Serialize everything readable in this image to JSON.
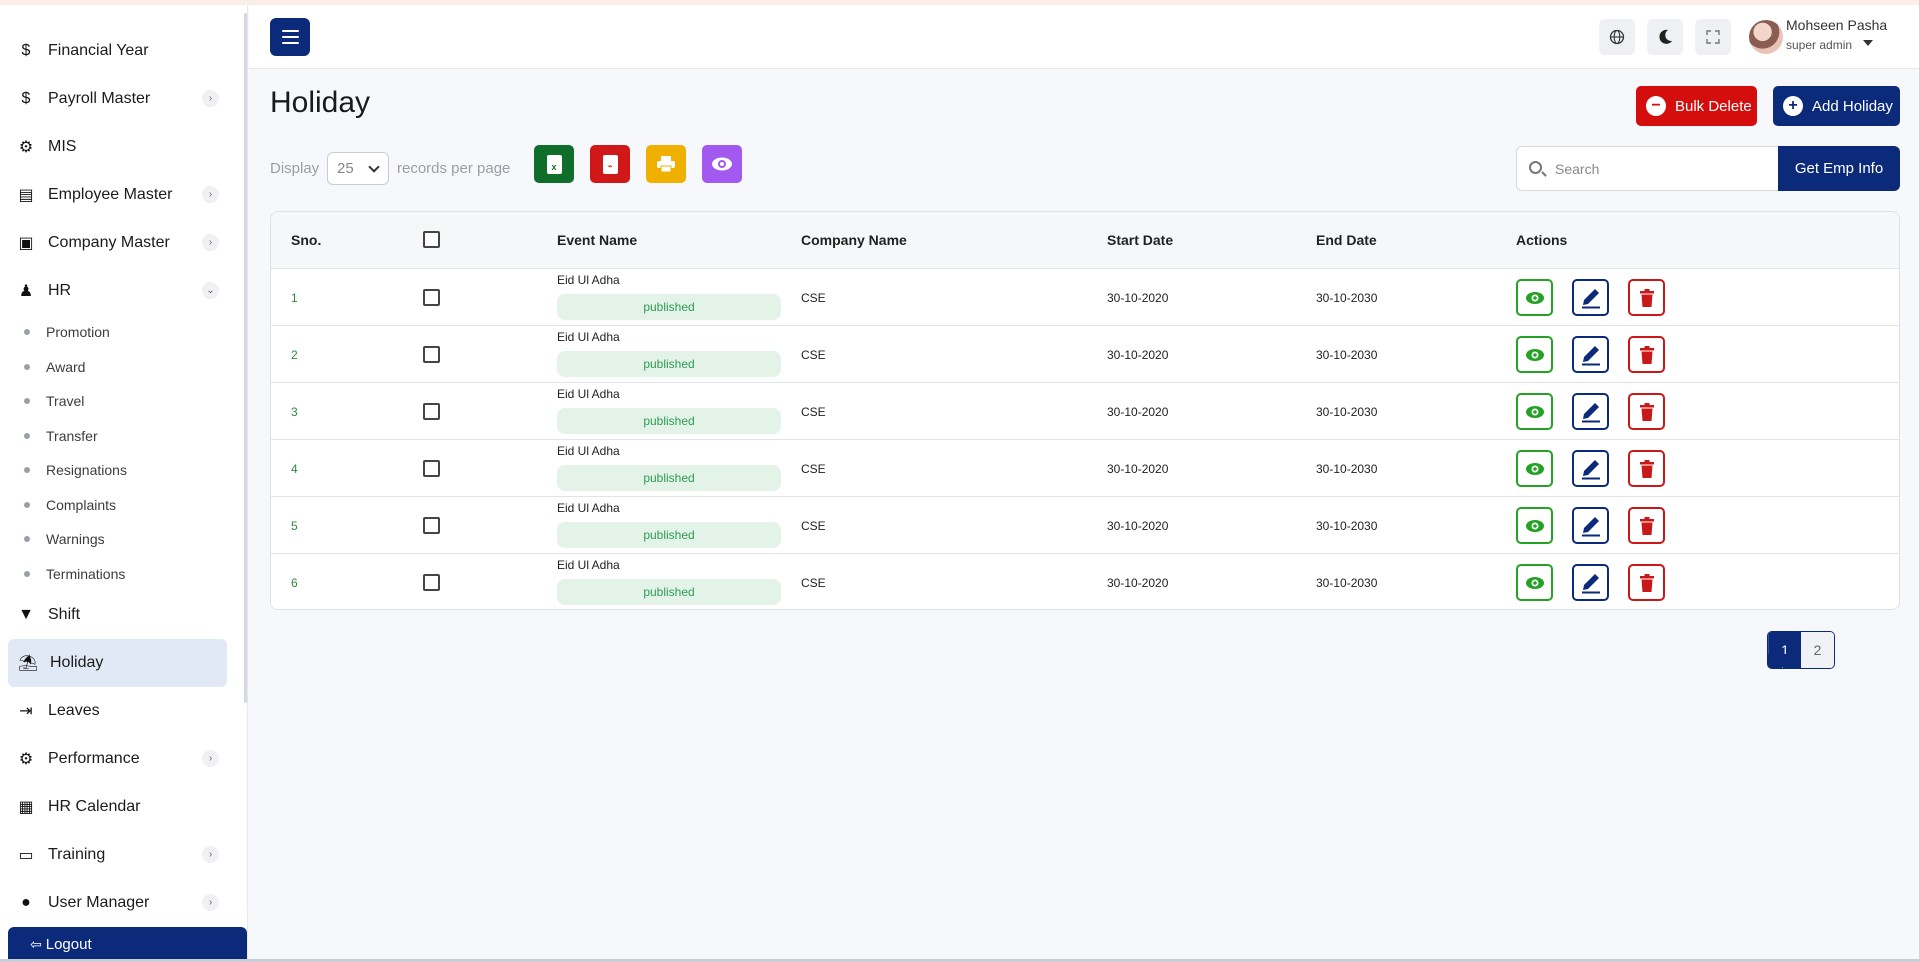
{
  "sidebar": {
    "items": [
      {
        "label": "Financial Year",
        "icon": "dollar-icon",
        "glyph": "$",
        "chevron": false
      },
      {
        "label": "Payroll Master",
        "icon": "dollar-icon",
        "glyph": "$",
        "chevron": true
      },
      {
        "label": "MIS",
        "icon": "user-gear-icon",
        "glyph": "⚙",
        "chevron": false
      },
      {
        "label": "Employee Master",
        "icon": "building-icon",
        "glyph": "▤",
        "chevron": true
      },
      {
        "label": "Company Master",
        "icon": "briefcase-icon",
        "glyph": "▣",
        "chevron": true
      },
      {
        "label": "HR",
        "icon": "users-icon",
        "glyph": "♟",
        "chevron": true,
        "expanded": true
      }
    ],
    "hr_sub_items": [
      "Promotion",
      "Award",
      "Travel",
      "Transfer",
      "Resignations",
      "Complaints",
      "Warnings",
      "Terminations"
    ],
    "items_after": [
      {
        "label": "Shift",
        "icon": "filter-icon",
        "glyph": "▼",
        "chevron": false
      },
      {
        "label": "Holiday",
        "icon": "umbrella-beach-icon",
        "glyph": "⛱",
        "chevron": false,
        "active": true
      },
      {
        "label": "Leaves",
        "icon": "sign-out-icon",
        "glyph": "⇥",
        "chevron": false
      },
      {
        "label": "Performance",
        "icon": "gears-icon",
        "glyph": "⚙",
        "chevron": true
      },
      {
        "label": "HR Calendar",
        "icon": "calendar-icon",
        "glyph": "▦",
        "chevron": false
      },
      {
        "label": "Training",
        "icon": "chalkboard-icon",
        "glyph": "▭",
        "chevron": true
      },
      {
        "label": "User Manager",
        "icon": "user-icon",
        "glyph": "●",
        "chevron": true
      }
    ],
    "logout_label": "Logout"
  },
  "topbar": {
    "user_name": "Mohseen Pasha",
    "user_role": "super admin"
  },
  "page": {
    "title": "Holiday",
    "bulk_delete_label": "Bulk Delete",
    "add_label": "Add Holiday",
    "display_label": "Display",
    "page_size": "25",
    "records_label": "records per page",
    "search_placeholder": "Search",
    "get_emp_label": "Get Emp Info"
  },
  "colors": {
    "primary": "#0b2a7a",
    "danger": "#d40d0d",
    "excel": "#0e6e2a",
    "pdf": "#d01818",
    "print": "#f0b000",
    "view": "#a259f0",
    "published_bg": "#e4f3e8",
    "published_text": "#2d9b52"
  },
  "table": {
    "columns": [
      "Sno.",
      "",
      "Event Name",
      "Company Name",
      "Start Date",
      "End Date",
      "Actions"
    ],
    "rows": [
      {
        "sno": "1",
        "event": "Eid Ul Adha",
        "status": "published",
        "company": "CSE",
        "start": "30-10-2020",
        "end": "30-10-2030"
      },
      {
        "sno": "2",
        "event": "Eid Ul Adha",
        "status": "published",
        "company": "CSE",
        "start": "30-10-2020",
        "end": "30-10-2030"
      },
      {
        "sno": "3",
        "event": "Eid Ul Adha",
        "status": "published",
        "company": "CSE",
        "start": "30-10-2020",
        "end": "30-10-2030"
      },
      {
        "sno": "4",
        "event": "Eid Ul Adha",
        "status": "published",
        "company": "CSE",
        "start": "30-10-2020",
        "end": "30-10-2030"
      },
      {
        "sno": "5",
        "event": "Eid Ul Adha",
        "status": "published",
        "company": "CSE",
        "start": "30-10-2020",
        "end": "30-10-2030"
      },
      {
        "sno": "6",
        "event": "Eid Ul Adha",
        "status": "published",
        "company": "CSE",
        "start": "30-10-2020",
        "end": "30-10-2030"
      }
    ]
  },
  "pagination": {
    "pages": [
      "1",
      "2"
    ],
    "current": "1"
  }
}
